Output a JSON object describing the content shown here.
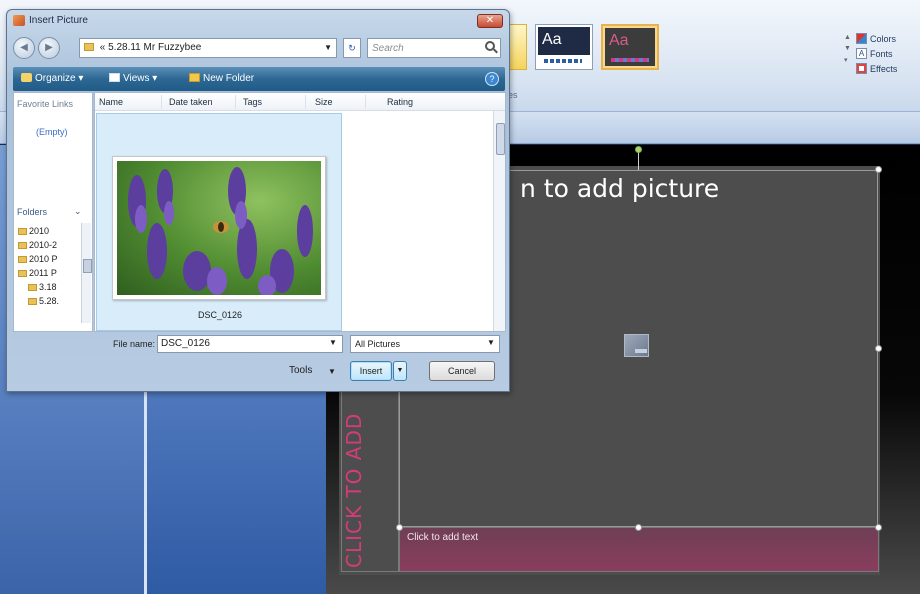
{
  "dialog": {
    "title": "Insert Picture",
    "close_label": "✕",
    "address": {
      "chevron": "«",
      "path": "5.28.11 Mr Fuzzybee"
    },
    "search_placeholder": "Search",
    "toolbar": {
      "organize": "Organize",
      "views": "Views",
      "new_folder": "New Folder",
      "help": "?"
    },
    "left_nav": {
      "favorite_links": "Favorite Links",
      "empty": "(Empty)",
      "folders": "Folders",
      "tree": [
        "2010",
        "2010-2",
        "2010 P",
        "2011 P",
        "3.18",
        "5.28."
      ]
    },
    "columns": [
      "Name",
      "Date taken",
      "Tags",
      "Size",
      "Rating"
    ],
    "file": {
      "caption": "DSC_0126"
    },
    "file_name_label": "File name:",
    "file_name_value": "DSC_0126",
    "filter_value": "All Pictures",
    "tools_label": "Tools",
    "insert_label": "Insert",
    "cancel_label": "Cancel"
  },
  "ribbon": {
    "theme_text": "Aa",
    "group_label": "es",
    "options": {
      "colors": "Colors",
      "fonts": "Fonts",
      "effects": "Effects"
    }
  },
  "slide": {
    "picture_placeholder_text": "n to add picture",
    "vertical_text": "CLICK TO ADD",
    "text_placeholder": "Click to add text"
  },
  "colors": {
    "accent_pink": "#d43c78",
    "toolbar_blue": "#2d6793",
    "slide_gray": "#4d4d4d"
  }
}
